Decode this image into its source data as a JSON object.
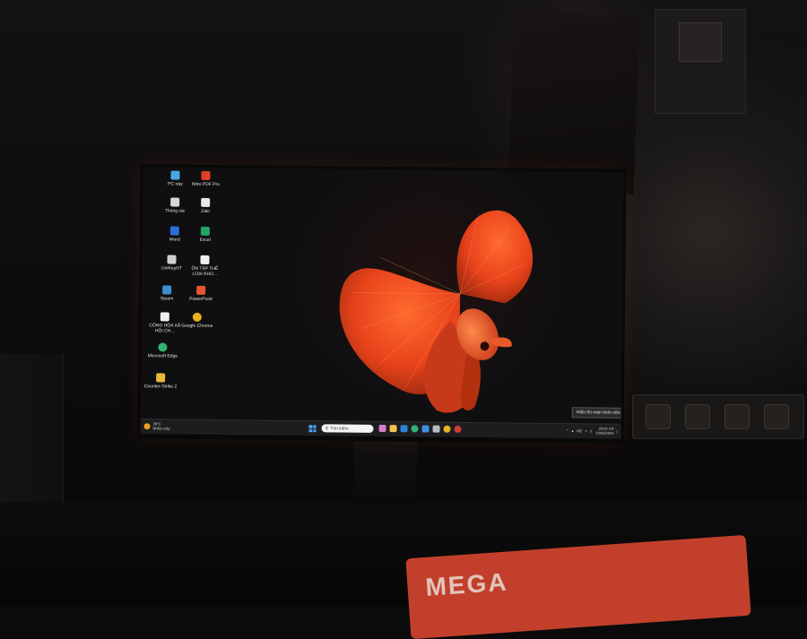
{
  "desktop": {
    "icons": [
      {
        "label": "PC này",
        "icon": "pc-icon",
        "color": "#49a6e8"
      },
      {
        "label": "Nitro PDF Pro",
        "icon": "nitro-pdf-icon",
        "color": "#e0402a"
      },
      {
        "label": "Thùng rác",
        "icon": "recycle-bin-icon",
        "color": "#d9d9d9"
      },
      {
        "label": "Zalo",
        "icon": "zalo-icon",
        "color": "#e8e8e8"
      },
      {
        "label": "Word",
        "icon": "word-icon",
        "color": "#2b6fd6"
      },
      {
        "label": "Excel",
        "icon": "excel-icon",
        "color": "#21a366"
      },
      {
        "label": "UniKeyNT",
        "icon": "unikey-icon",
        "color": "#cfcfcf"
      },
      {
        "label": "ÔN TẬP THẾ LOẠI KHO...",
        "icon": "document-icon",
        "color": "#f0f0f0"
      },
      {
        "label": "Steam",
        "icon": "steam-icon",
        "color": "#3c8fd0"
      },
      {
        "label": "PowerPoint",
        "icon": "powerpoint-icon",
        "color": "#e4572e"
      },
      {
        "label": "CỘNG HÒA XÃ HỘI CH...",
        "icon": "document-icon",
        "color": "#f0f0f0"
      },
      {
        "label": "Google Chrome",
        "icon": "chrome-icon",
        "color": "#e8b31f"
      },
      {
        "label": "Microsoft Edge",
        "icon": "edge-icon",
        "color": "#33b36e"
      },
      {
        "label": "Counter-Strike 2",
        "icon": "counter-strike-icon",
        "color": "#e8b93a"
      }
    ]
  },
  "taskbar": {
    "weather_temp": "28°C",
    "weather_desc": "Nhiều mây",
    "search_placeholder": "Tìm kiếm",
    "pinned": [
      {
        "icon": "copilot-icon",
        "color": "#d77ad0"
      },
      {
        "icon": "file-explorer-icon",
        "color": "#f2c14e"
      },
      {
        "icon": "mail-icon",
        "color": "#2f7fd6"
      },
      {
        "icon": "edge-taskbar-icon",
        "color": "#2fb47a"
      },
      {
        "icon": "store-icon",
        "color": "#3a8fe0"
      },
      {
        "icon": "app-icon",
        "color": "#bbbbbb"
      },
      {
        "icon": "chrome-taskbar-icon",
        "color": "#e8b31f"
      },
      {
        "icon": "app-icon-2",
        "color": "#cf3c3c"
      }
    ],
    "tray_lang": "VIE",
    "clock_time": "20:02 CH",
    "clock_date": "10/05/2024"
  },
  "tooltip": "Hiển thị màn hình nền",
  "wallpaper": {
    "subject": "red betta fish",
    "color": "#e8431b"
  },
  "mousepad": {
    "text": "MEGA"
  }
}
